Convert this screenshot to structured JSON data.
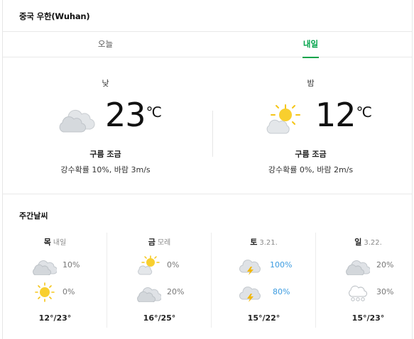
{
  "location": {
    "title": "중국 우한(Wuhan)"
  },
  "tabs": [
    {
      "label": "오늘",
      "active": false
    },
    {
      "label": "내일",
      "active": true
    }
  ],
  "forecast": {
    "day": {
      "period": "낮",
      "icon": "cloudy-icon",
      "temp": "23",
      "unit": "℃",
      "condition": "구름 조금",
      "detail": "강수확률 10%, 바람 3m/s"
    },
    "night": {
      "period": "밤",
      "icon": "partly-cloudy-icon",
      "temp": "12",
      "unit": "℃",
      "condition": "구름 조금",
      "detail": "강수확률 0%, 바람 2m/s"
    }
  },
  "weekly": {
    "title": "주간날씨",
    "days": [
      {
        "name": "목",
        "sub": "내일",
        "am": {
          "icon": "cloudy-icon",
          "pct": "10%"
        },
        "pm": {
          "icon": "sunny-icon",
          "pct": "0%"
        },
        "minmax": "12°/23°"
      },
      {
        "name": "금",
        "sub": "모레",
        "am": {
          "icon": "partly-cloudy-icon",
          "pct": "0%"
        },
        "pm": {
          "icon": "cloudy-icon",
          "pct": "20%"
        },
        "minmax": "16°/25°"
      },
      {
        "name": "토",
        "sub": "3.21.",
        "am": {
          "icon": "thunderstorm-icon",
          "pct": "100%"
        },
        "pm": {
          "icon": "thunderstorm-icon",
          "pct": "80%"
        },
        "minmax": "15°/22°"
      },
      {
        "name": "일",
        "sub": "3.22.",
        "am": {
          "icon": "cloudy-icon",
          "pct": "20%"
        },
        "pm": {
          "icon": "snow-cloud-icon",
          "pct": "30%"
        },
        "minmax": "15°/23°"
      }
    ]
  },
  "colors": {
    "accent": "#00a34a",
    "rain_text": "#3b9be0",
    "sun": "#f5c518",
    "cloud": "#d9dde1",
    "bolt": "#f2b705"
  }
}
